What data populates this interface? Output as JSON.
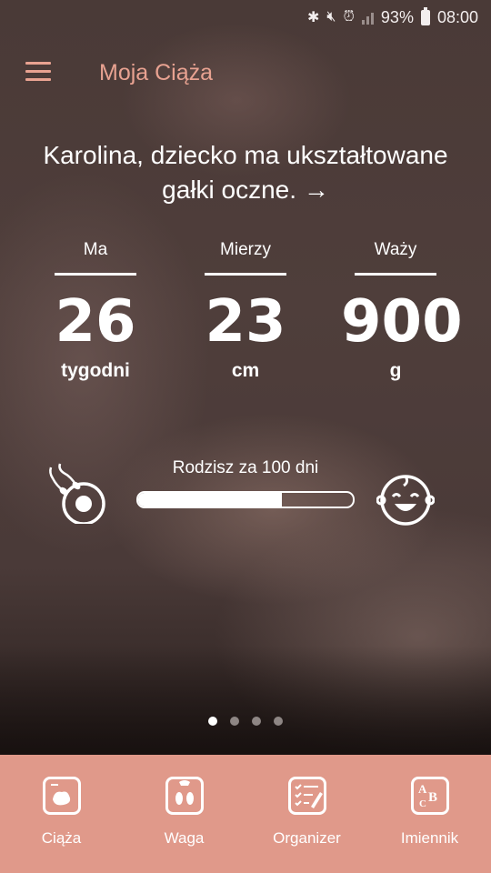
{
  "status": {
    "battery": "93%",
    "time": "08:00"
  },
  "appbar": {
    "title": "Moja Ciąża"
  },
  "headline": {
    "text": "Karolina, dziecko ma ukształtowane gałki oczne. →"
  },
  "stats": [
    {
      "label": "Ma",
      "value": "26",
      "unit": "tygodni"
    },
    {
      "label": "Mierzy",
      "value": "23",
      "unit": "cm"
    },
    {
      "label": "Waży",
      "value": "900",
      "unit": "g"
    }
  ],
  "progress": {
    "label": "Rodzisz za 100 dni",
    "fraction": 0.67
  },
  "pager": {
    "count": 4,
    "active": 0
  },
  "bottom_nav": [
    {
      "label": "Ciąża",
      "icon": "ultrasound-icon"
    },
    {
      "label": "Waga",
      "icon": "scale-icon"
    },
    {
      "label": "Organizer",
      "icon": "checklist-icon"
    },
    {
      "label": "Imiennik",
      "icon": "abc-icon"
    }
  ],
  "colors": {
    "accent": "#e8a291",
    "bottom_bar": "#e0998a"
  }
}
